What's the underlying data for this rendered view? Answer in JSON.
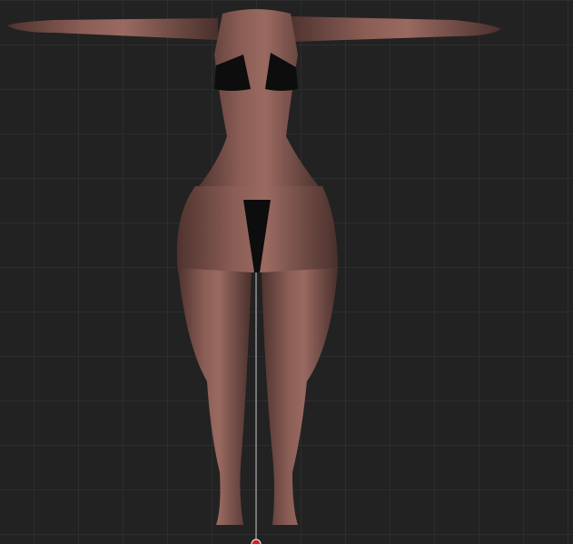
{
  "viewport": {
    "background_color": "#222222",
    "grid_color": "#2d2d2d",
    "grid_visible": true
  },
  "model": {
    "pose": "T-pose",
    "view": "front",
    "skin_color": "#7a5049",
    "clothing_color": "#0d0d0d"
  },
  "gizmo": {
    "axis_line_color": "#c8c8c8",
    "pivot_color": "#cc2222"
  }
}
